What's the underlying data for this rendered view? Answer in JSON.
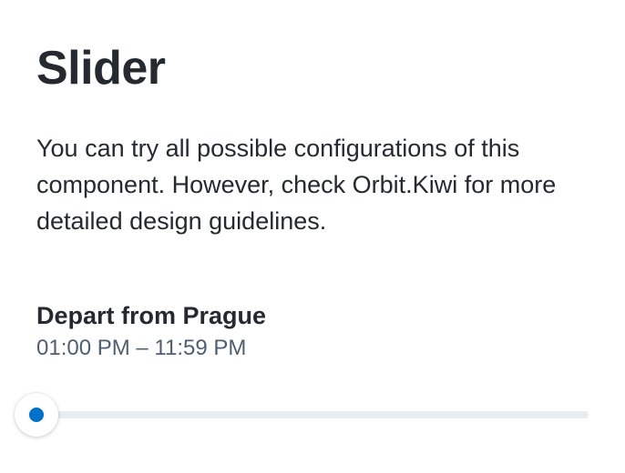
{
  "page": {
    "title": "Slider",
    "intro": "You can try all possible configurations of this component. However, check Orbit.Kiwi for more detailed design guidelines."
  },
  "slider": {
    "label": "Depart from Prague",
    "value_text": "01:00 PM – 11:59 PM",
    "value_fraction": 0,
    "accent_color": "#0172cb",
    "track_color": "#e8edf1"
  }
}
